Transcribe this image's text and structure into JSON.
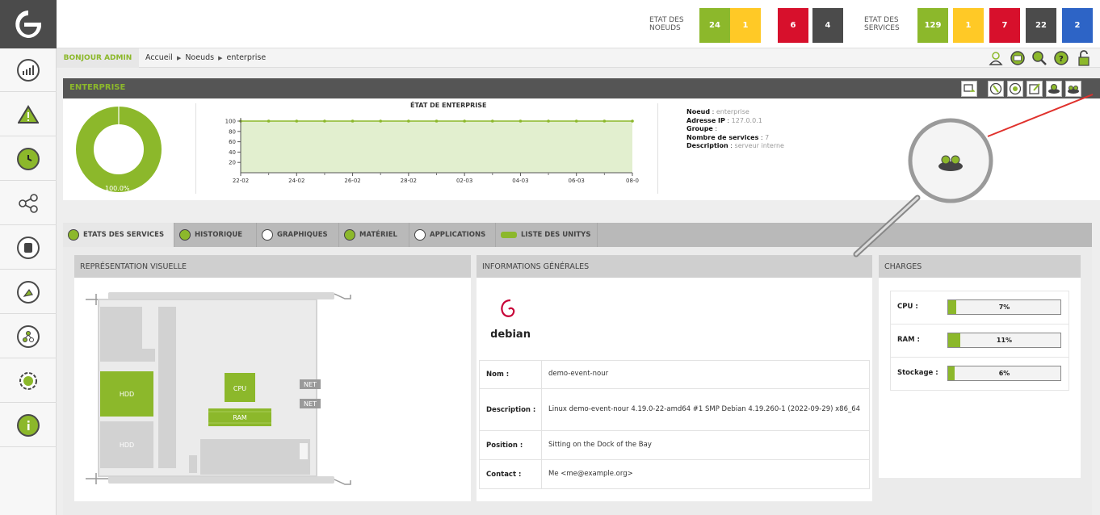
{
  "app": {
    "logo_icon": "eyes-of-network-logo",
    "sidebar_icons": [
      "dashboard-chart-icon",
      "alert-triangle-icon",
      "history-clock-icon",
      "share-nodes-icon",
      "server-icon",
      "satellite-dish-icon",
      "process-flow-icon",
      "gear-icon",
      "info-icon"
    ]
  },
  "status": {
    "nodes_label": "ETAT DES NOEUDS",
    "nodes": [
      "24",
      "1",
      "6",
      "4"
    ],
    "services_label": "ETAT DES SERVICES",
    "services": [
      "129",
      "1",
      "7",
      "22",
      "2"
    ],
    "colors": {
      "green": "#8cb82b",
      "yellow": "#ffc926",
      "red": "#d7102c",
      "gray": "#4b4b4b",
      "blue": "#2d64c6"
    }
  },
  "header": {
    "greeting": "BONJOUR ADMIN",
    "breadcrumbs": [
      "Accueil",
      "Noeuds",
      "enterprise"
    ],
    "top_icons": [
      "user-icon",
      "mail-icon",
      "search-icon",
      "help-icon",
      "lock-icon"
    ]
  },
  "enterprise": {
    "title": "ENTERPRISE",
    "donut_label": "100.0%",
    "chart_title": "ÉTAT DE ENTERPRISE",
    "node_label": "Noeud",
    "node_value": "enterprise",
    "ip_label": "Adresse IP",
    "ip_value": "127.0.0.1",
    "group_label": "Groupe",
    "group_value": "",
    "services_count_label": "Nombre de services",
    "services_count_value": "7",
    "description_label": "Description",
    "description_value": "serveur interne",
    "header_buttons": [
      "export-icon",
      "nagios-icon",
      "graph-icon",
      "edit-icon",
      "unity-icon",
      "equipment-icon"
    ]
  },
  "chart_data": {
    "type": "area",
    "title": "ÉTAT DE ENTERPRISE",
    "x": [
      "22-02",
      "23-02",
      "24-02",
      "25-02",
      "26-02",
      "27-02",
      "28-02",
      "01-03",
      "02-03",
      "03-03",
      "04-03",
      "05-03",
      "06-03",
      "07-03",
      "08-03"
    ],
    "x_tick_labels": [
      "22-02",
      "24-02",
      "26-02",
      "28-02",
      "02-03",
      "04-03",
      "06-03",
      "08-0"
    ],
    "series": [
      {
        "values": [
          100,
          100,
          100,
          100,
          100,
          100,
          100,
          100,
          100,
          100,
          100,
          100,
          100,
          100,
          100
        ]
      }
    ],
    "y_ticks": [
      "20",
      "40",
      "60",
      "80",
      "100"
    ],
    "ylim": [
      0,
      100
    ],
    "color": "#8cb82b",
    "fill": "#e2efcf"
  },
  "tabs": [
    {
      "label": "ETATS DES SERVICES",
      "icon": "services-icon"
    },
    {
      "label": "HISTORIQUE",
      "icon": "history-icon"
    },
    {
      "label": "GRAPHIQUES",
      "icon": "graph-icon"
    },
    {
      "label": "MATÉRIEL",
      "icon": "hardware-icon"
    },
    {
      "label": "APPLICATIONS",
      "icon": "applications-icon"
    },
    {
      "label": "LISTE DES UNITYS",
      "icon": "unity-list-icon"
    }
  ],
  "visual": {
    "title": "REPRÉSENTATION VISUELLE",
    "hdd1": "HDD",
    "hdd2": "HDD",
    "cpu": "CPU",
    "ram": "RAM",
    "net1": "NET",
    "net2": "NET"
  },
  "general": {
    "title": "INFORMATIONS GÉNÉRALES",
    "os_logo_text": "debian",
    "rows": [
      {
        "key": "Nom :",
        "value": "demo-event-nour"
      },
      {
        "key": "Description :",
        "value": "Linux demo-event-nour 4.19.0-22-amd64 #1 SMP Debian 4.19.260-1 (2022-09-29) x86_64"
      },
      {
        "key": "Position :",
        "value": "Sitting on the Dock of the Bay"
      },
      {
        "key": "Contact :",
        "value": "Me <me@example.org>"
      }
    ]
  },
  "charges": {
    "title": "CHARGES",
    "items": [
      {
        "label": "CPU :",
        "value": "7%",
        "fraction": 0.07
      },
      {
        "label": "RAM :",
        "value": "11%",
        "fraction": 0.11
      },
      {
        "label": "Stockage :",
        "value": "6%",
        "fraction": 0.06
      }
    ]
  }
}
